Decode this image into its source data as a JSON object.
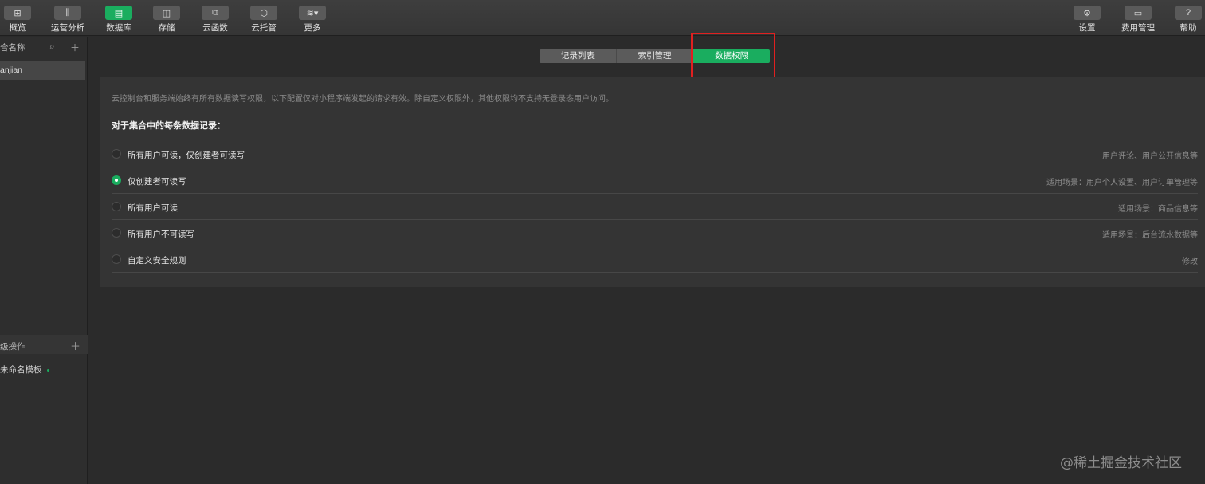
{
  "toolbar": {
    "left": [
      {
        "label": "概览",
        "icon": "overview-icon",
        "glyph": "⊞"
      },
      {
        "label": "运营分析",
        "icon": "chart-icon",
        "glyph": "⫼"
      },
      {
        "label": "数据库",
        "icon": "database-icon",
        "glyph": "▤"
      },
      {
        "label": "存储",
        "icon": "storage-icon",
        "glyph": "◫"
      },
      {
        "label": "云函数",
        "icon": "function-icon",
        "glyph": "⧉"
      },
      {
        "label": "云托管",
        "icon": "cube-icon",
        "glyph": "⬡"
      },
      {
        "label": "更多",
        "icon": "layers-icon",
        "glyph": "≋▾"
      }
    ],
    "right": [
      {
        "label": "设置",
        "icon": "gear-icon",
        "glyph": "⚙"
      },
      {
        "label": "费用管理",
        "icon": "billing-icon",
        "glyph": "▭"
      },
      {
        "label": "帮助",
        "icon": "help-icon",
        "glyph": "?"
      }
    ],
    "active_color": "#1aad5f"
  },
  "sidebar": {
    "collections_header": "合名称",
    "collection_item": "anjian",
    "advanced_header": "级操作",
    "template_item": "未命名模板"
  },
  "tabs": [
    "记录列表",
    "索引管理",
    "数据权限"
  ],
  "permissions": {
    "description": "云控制台和服务端始终有所有数据读写权限，以下配置仅对小程序端发起的请求有效。除自定义权限外，其他权限均不支持无登录态用户访问。",
    "heading": "对于集合中的每条数据记录：",
    "options": [
      {
        "label": "所有用户可读，仅创建者可读写",
        "hint": "用户评论、用户公开信息等"
      },
      {
        "label": "仅创建者可读写",
        "hint": "适用场景：用户个人设置、用户订单管理等"
      },
      {
        "label": "所有用户可读",
        "hint": "适用场景：商品信息等"
      },
      {
        "label": "所有用户不可读写",
        "hint": "适用场景：后台流水数据等"
      },
      {
        "label": "自定义安全规则",
        "hint": "修改"
      }
    ],
    "selected_index": 1
  },
  "watermark": "@稀土掘金技术社区"
}
